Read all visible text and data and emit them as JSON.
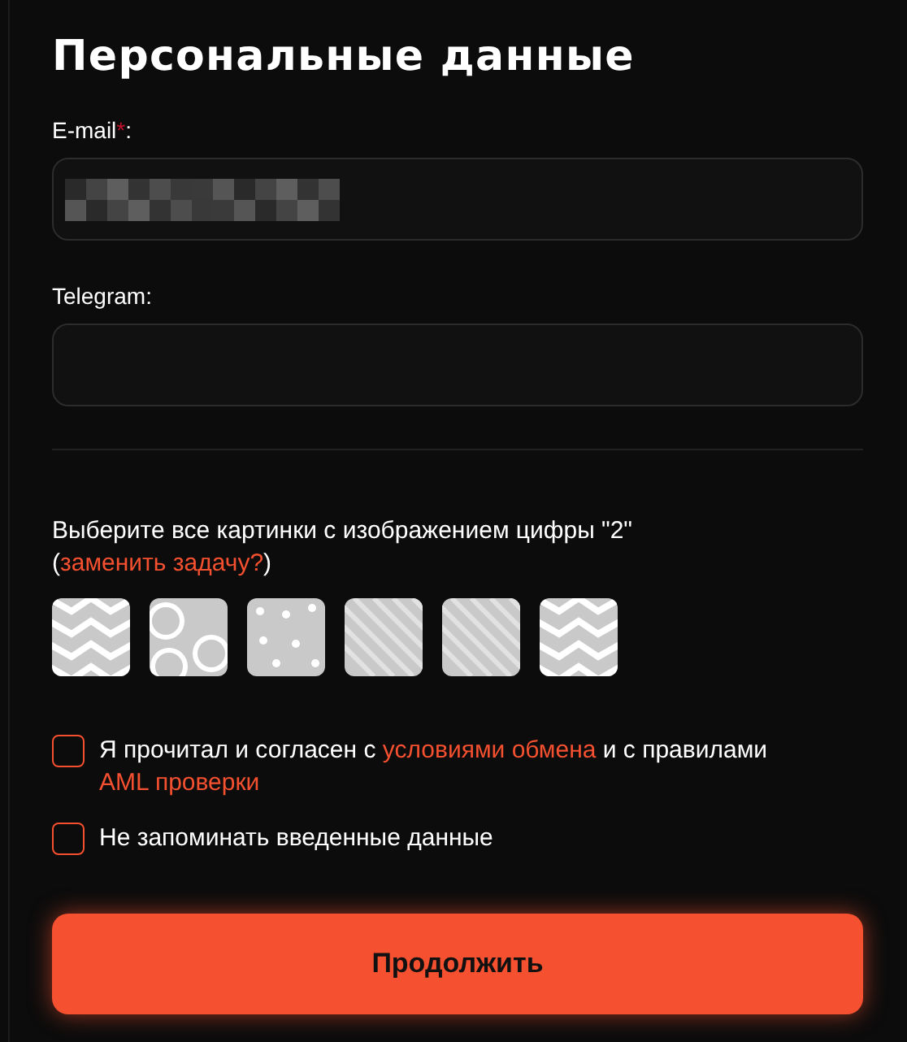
{
  "title": "Персональные данные",
  "fields": [
    {
      "label": "E-mail",
      "required_mark": "*",
      "colon": ":",
      "redacted": true
    },
    {
      "label": "Telegram",
      "colon": ":",
      "redacted": false
    }
  ],
  "captcha": {
    "prompt": [
      {
        "kind": "text",
        "text": "Выберите все картинки с изображением цифры \"2\" ("
      },
      {
        "kind": "link",
        "text": "заменить задачу?"
      },
      {
        "kind": "text",
        "text": ")"
      }
    ]
  },
  "checkboxes": [
    {
      "checked": false,
      "label": [
        {
          "kind": "text",
          "text": "Я прочитал и согласен с "
        },
        {
          "kind": "link",
          "text": "условиями обмена"
        },
        {
          "kind": "text",
          "text": " и с правилами "
        },
        {
          "kind": "link",
          "text": "AML проверки"
        }
      ]
    },
    {
      "checked": false,
      "label": [
        {
          "kind": "text",
          "text": "Не запоминать введенные данные"
        }
      ]
    }
  ],
  "submit": "Продолжить"
}
